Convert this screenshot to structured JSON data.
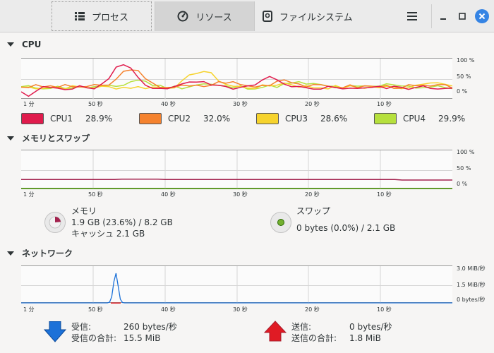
{
  "tabs": {
    "processes": "プロセス",
    "resources": "リソース",
    "filesystems": "ファイルシステム"
  },
  "cpu": {
    "title": "CPU",
    "y_ticks": [
      "100 %",
      "50 %",
      "0 %"
    ],
    "x_ticks": [
      "1 分",
      "50 秒",
      "40 秒",
      "30 秒",
      "20 秒",
      "10 秒"
    ],
    "legend": [
      {
        "name": "CPU1",
        "value": "28.9%",
        "color": "#e01b4c"
      },
      {
        "name": "CPU2",
        "value": "32.0%",
        "color": "#f5822e"
      },
      {
        "name": "CPU3",
        "value": "28.6%",
        "color": "#f6d32d"
      },
      {
        "name": "CPU4",
        "value": "29.9%",
        "color": "#b6e03d"
      }
    ]
  },
  "memory": {
    "title": "メモリとスワップ",
    "y_ticks": [
      "100 %",
      "50 %",
      "0 %"
    ],
    "x_ticks": [
      "1 分",
      "50 秒",
      "40 秒",
      "30 秒",
      "20 秒",
      "10 秒"
    ],
    "mem_label": "メモリ",
    "mem_value": "1.9 GB (23.6%) / 8.2 GB",
    "cache_value": "キャッシュ 2.1 GB",
    "swap_label": "スワップ",
    "swap_value": "0 bytes (0.0%) / 2.1 GB",
    "mem_color": "#a3224e",
    "swap_color": "#4e9a06",
    "mem_fraction": 0.236,
    "swap_fraction": 0.0
  },
  "network": {
    "title": "ネットワーク",
    "y_ticks": [
      "3.0 MiB/秒",
      "1.5 MiB/秒",
      "0 bytes/秒"
    ],
    "x_ticks": [
      "1 分",
      "50 秒",
      "40 秒",
      "30 秒",
      "20 秒",
      "10 秒"
    ],
    "recv_label": "受信:",
    "recv_value": "260 bytes/秒",
    "recv_total_label": "受信の合計:",
    "recv_total_value": "15.5 MiB",
    "send_label": "送信:",
    "send_value": "0 bytes/秒",
    "send_total_label": "送信の合計:",
    "send_total_value": "1.8 MiB",
    "recv_color": "#1c71d8",
    "send_color": "#e01b24"
  }
}
